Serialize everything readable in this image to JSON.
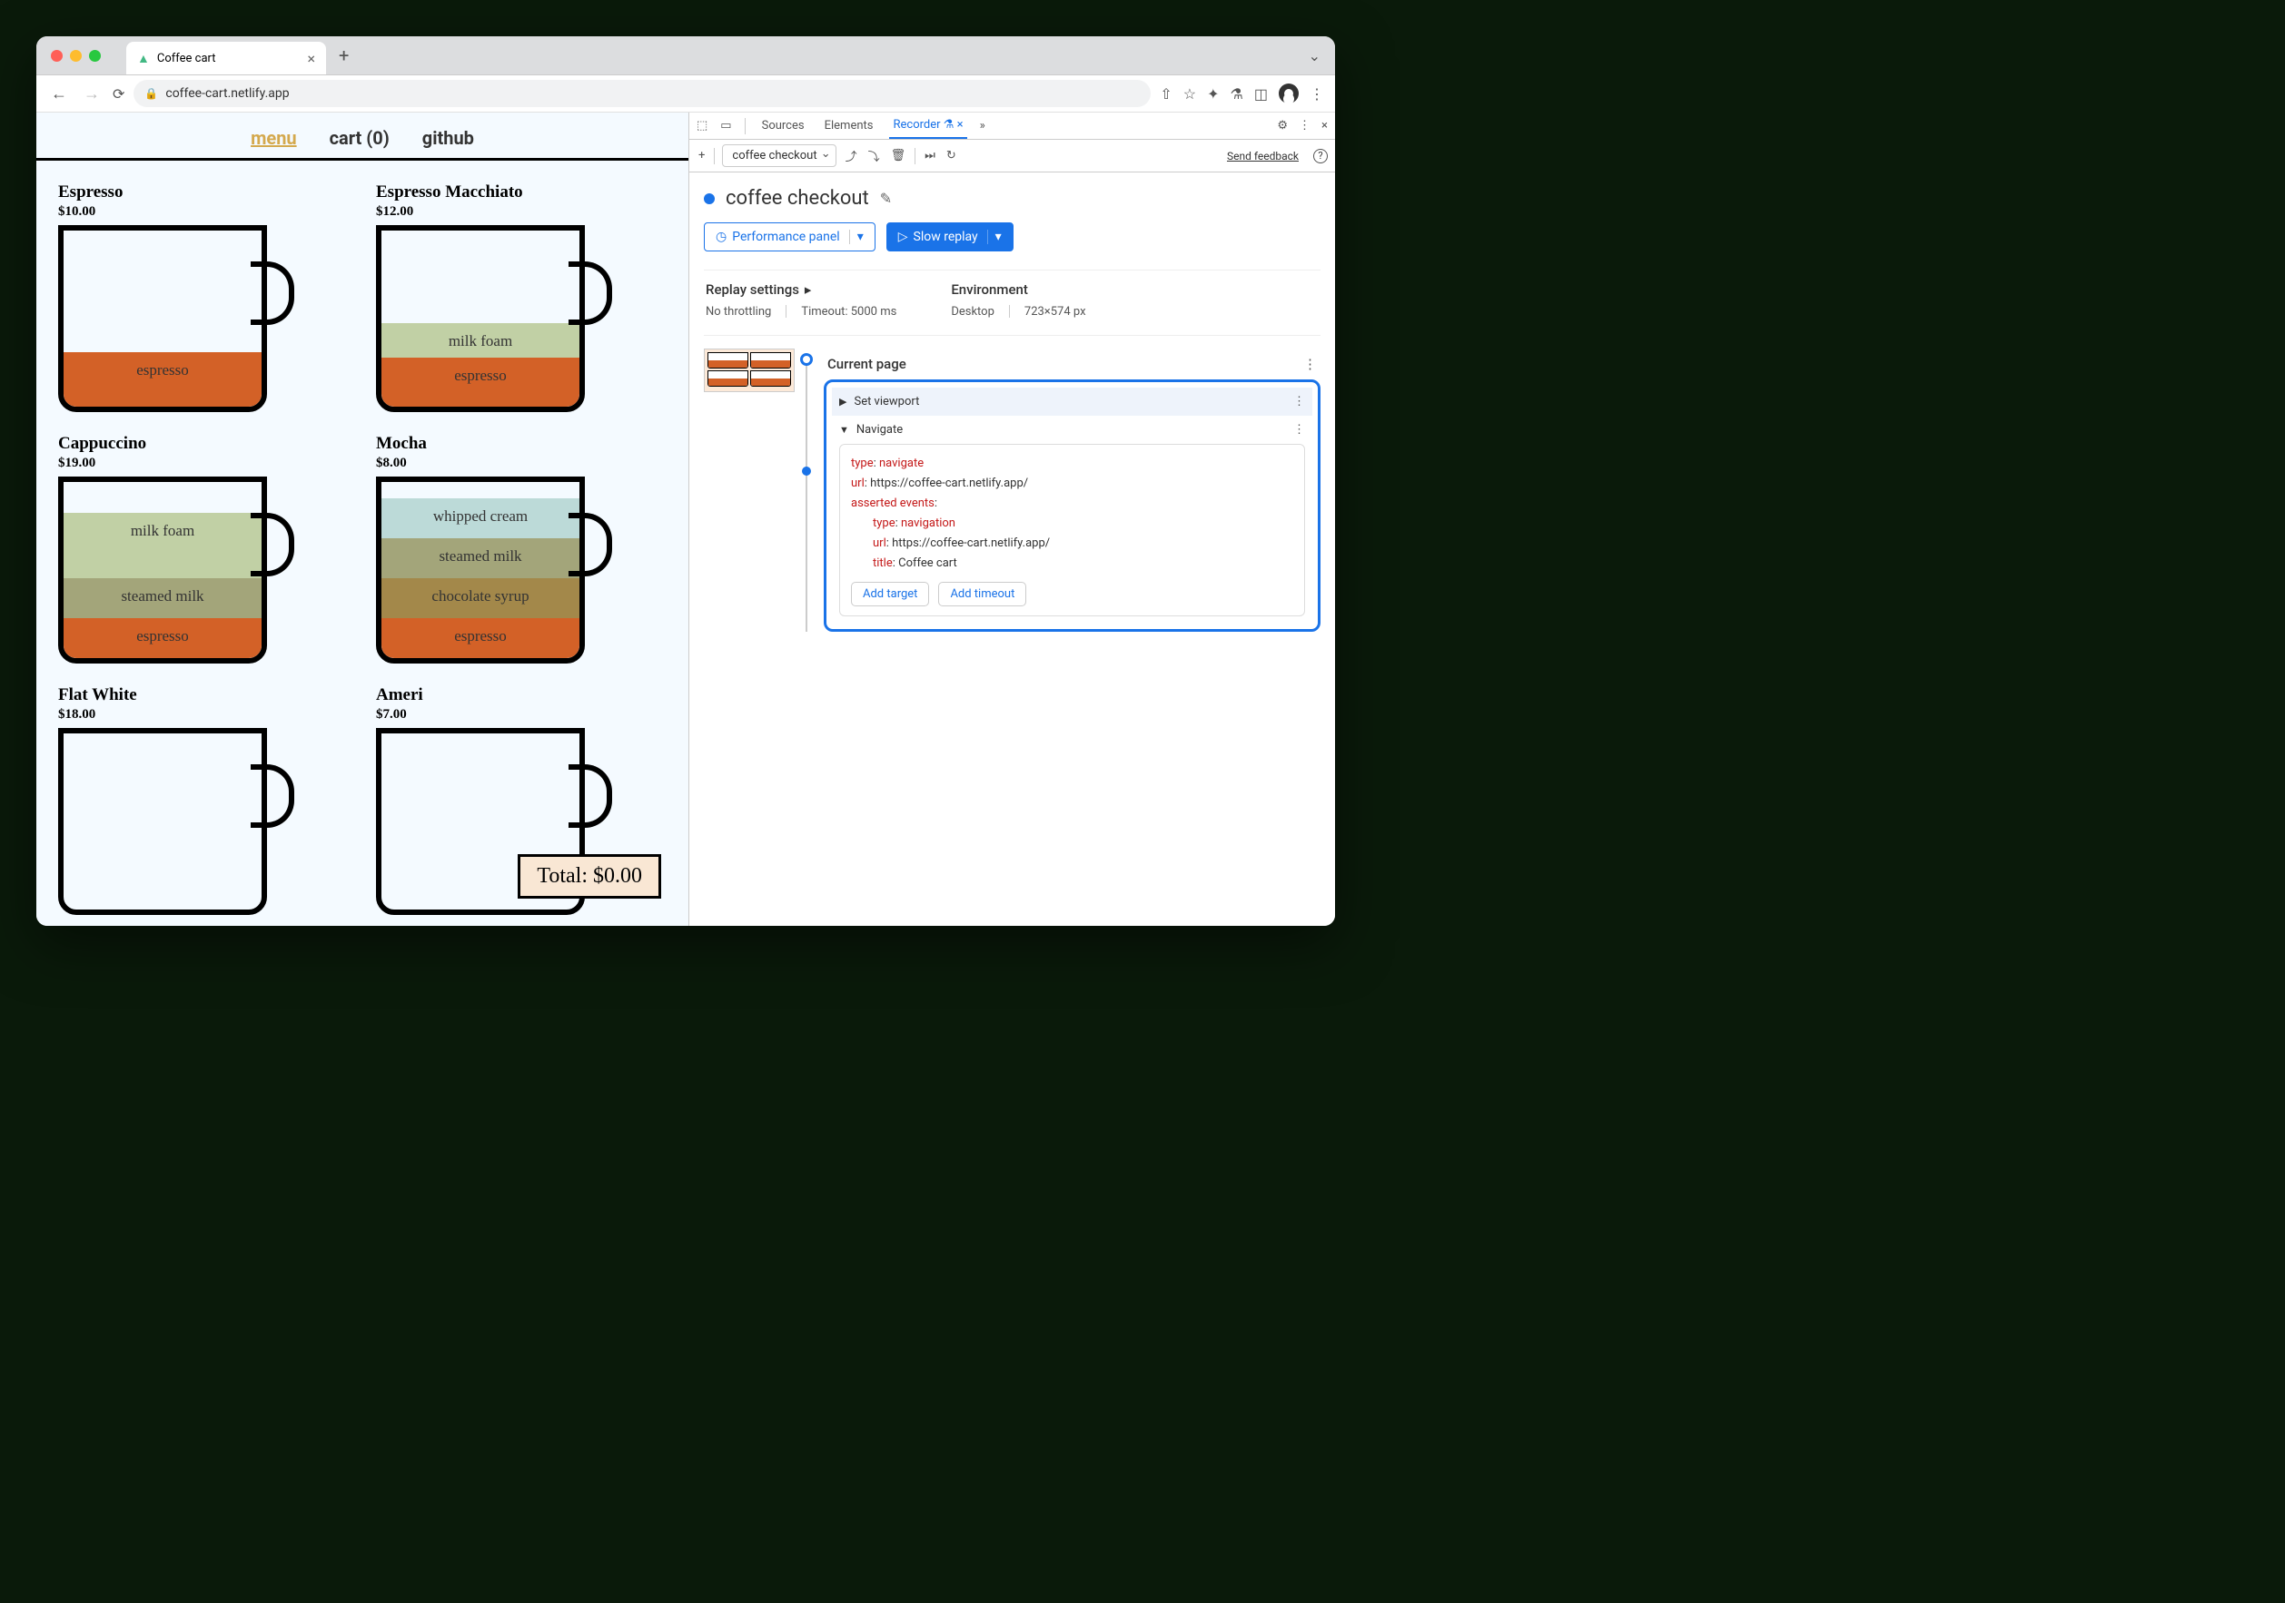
{
  "browser": {
    "tab_title": "Coffee cart",
    "url": "coffee-cart.netlify.app",
    "nav_back": "←",
    "nav_forward": "→"
  },
  "page": {
    "nav": {
      "menu": "menu",
      "cart": "cart (0)",
      "github": "github"
    },
    "total_label": "Total: $0.00",
    "products": [
      {
        "name": "Espresso",
        "price": "$10.00",
        "layers": [
          {
            "label": "espresso",
            "cls": "l-espresso",
            "h": 60
          }
        ]
      },
      {
        "name": "Espresso Macchiato",
        "price": "$12.00",
        "layers": [
          {
            "label": "milk foam",
            "cls": "l-milkfoam",
            "h": 38
          },
          {
            "label": "espresso",
            "cls": "l-espresso",
            "h": 54
          }
        ]
      },
      {
        "name": "Cappuccino",
        "price": "$19.00",
        "layers": [
          {
            "label": "milk foam",
            "cls": "l-milkfoam",
            "h": 72
          },
          {
            "label": "steamed milk",
            "cls": "l-steamedmilk",
            "h": 44
          },
          {
            "label": "espresso",
            "cls": "l-espresso",
            "h": 44
          }
        ]
      },
      {
        "name": "Mocha",
        "price": "$8.00",
        "layers": [
          {
            "label": "whipped cream",
            "cls": "l-whipped",
            "h": 44
          },
          {
            "label": "steamed milk",
            "cls": "l-steamedmilk",
            "h": 44
          },
          {
            "label": "chocolate syrup",
            "cls": "l-choc",
            "h": 44
          },
          {
            "label": "espresso",
            "cls": "l-espresso",
            "h": 44
          }
        ]
      },
      {
        "name": "Flat White",
        "price": "$18.00",
        "layers": []
      },
      {
        "name": "Ameri",
        "price": "$7.00",
        "layers": []
      }
    ]
  },
  "devtools": {
    "tabs": {
      "sources": "Sources",
      "elements": "Elements",
      "recorder": "Recorder"
    },
    "recording_name": "coffee checkout",
    "title": "coffee checkout",
    "perf_btn": "Performance panel",
    "replay_btn": "Slow replay",
    "send_feedback": "Send feedback",
    "replay_settings": {
      "title": "Replay settings",
      "throttling": "No throttling",
      "timeout": "Timeout: 5000 ms"
    },
    "environment": {
      "title": "Environment",
      "device": "Desktop",
      "viewport": "723×574 px"
    },
    "steps": {
      "current_page": "Current page",
      "set_viewport": "Set viewport",
      "navigate": "Navigate",
      "code": {
        "type_k": "type",
        "type_v": "navigate",
        "url_k": "url",
        "url_v": "https://coffee-cart.netlify.app/",
        "asserted_k": "asserted events",
        "a_type_k": "type",
        "a_type_v": "navigation",
        "a_url_k": "url",
        "a_url_v": "https://coffee-cart.netlify.app/",
        "a_title_k": "title",
        "a_title_v": "Coffee cart"
      },
      "add_target": "Add target",
      "add_timeout": "Add timeout"
    }
  }
}
